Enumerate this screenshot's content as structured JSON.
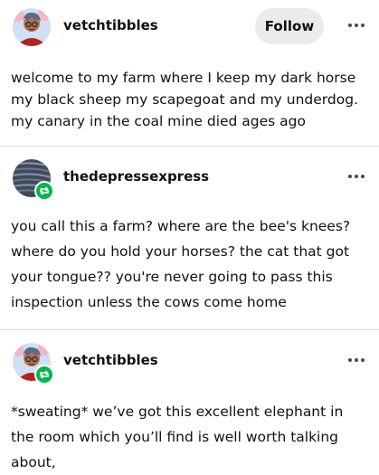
{
  "posts": [
    {
      "username": "vetchtibbles",
      "follow_label": "Follow",
      "avatar_icon": "vetchtibbles-avatar",
      "text": "welcome to my farm where I keep my dark horse my black sheep my scapegoat and my underdog. my canary in the coal mine died ages ago"
    },
    {
      "username": "thedepressexpress",
      "avatar_icon": "striped-avatar",
      "badge_icon": "reblog-icon",
      "text": "you call this a farm? where are the bee's knees? where do you hold your horses? the cat that got your tongue?? you're never going to pass this inspection unless the cows come home"
    },
    {
      "username": "vetchtibbles",
      "avatar_icon": "vetchtibbles-avatar",
      "badge_icon": "reblog-icon",
      "text": "*sweating* we’ve got this excellent elephant in the room which you’ll find is well worth talking about,"
    }
  ],
  "colors": {
    "reblog_green": "#00b84a",
    "follow_bg": "#ebebeb",
    "divider": "#dcdcdc"
  }
}
